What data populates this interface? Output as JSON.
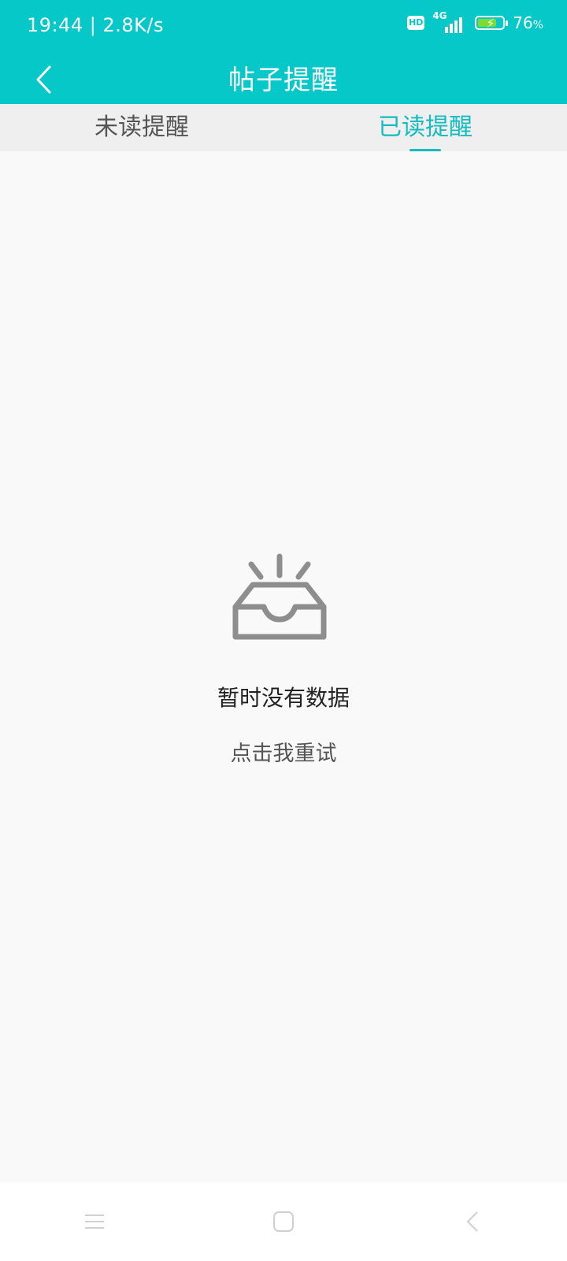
{
  "status_bar": {
    "time_speed": "19:44 | 2.8K/s",
    "hd": "HD",
    "network": "4G",
    "battery_percent": "76",
    "battery_percent_suffix": "%",
    "battery_level": 0.76
  },
  "header": {
    "title": "帖子提醒"
  },
  "tabs": [
    {
      "label": "未读提醒",
      "active": false
    },
    {
      "label": "已读提醒",
      "active": true
    }
  ],
  "empty_state": {
    "message": "暂时没有数据",
    "retry_label": "点击我重试"
  },
  "colors": {
    "brand": "#06c8c8",
    "tab_active": "#14bcc0",
    "icon_gray": "#8e8e8e"
  },
  "icons": [
    "back-arrow",
    "empty-inbox",
    "menu",
    "home",
    "back"
  ]
}
